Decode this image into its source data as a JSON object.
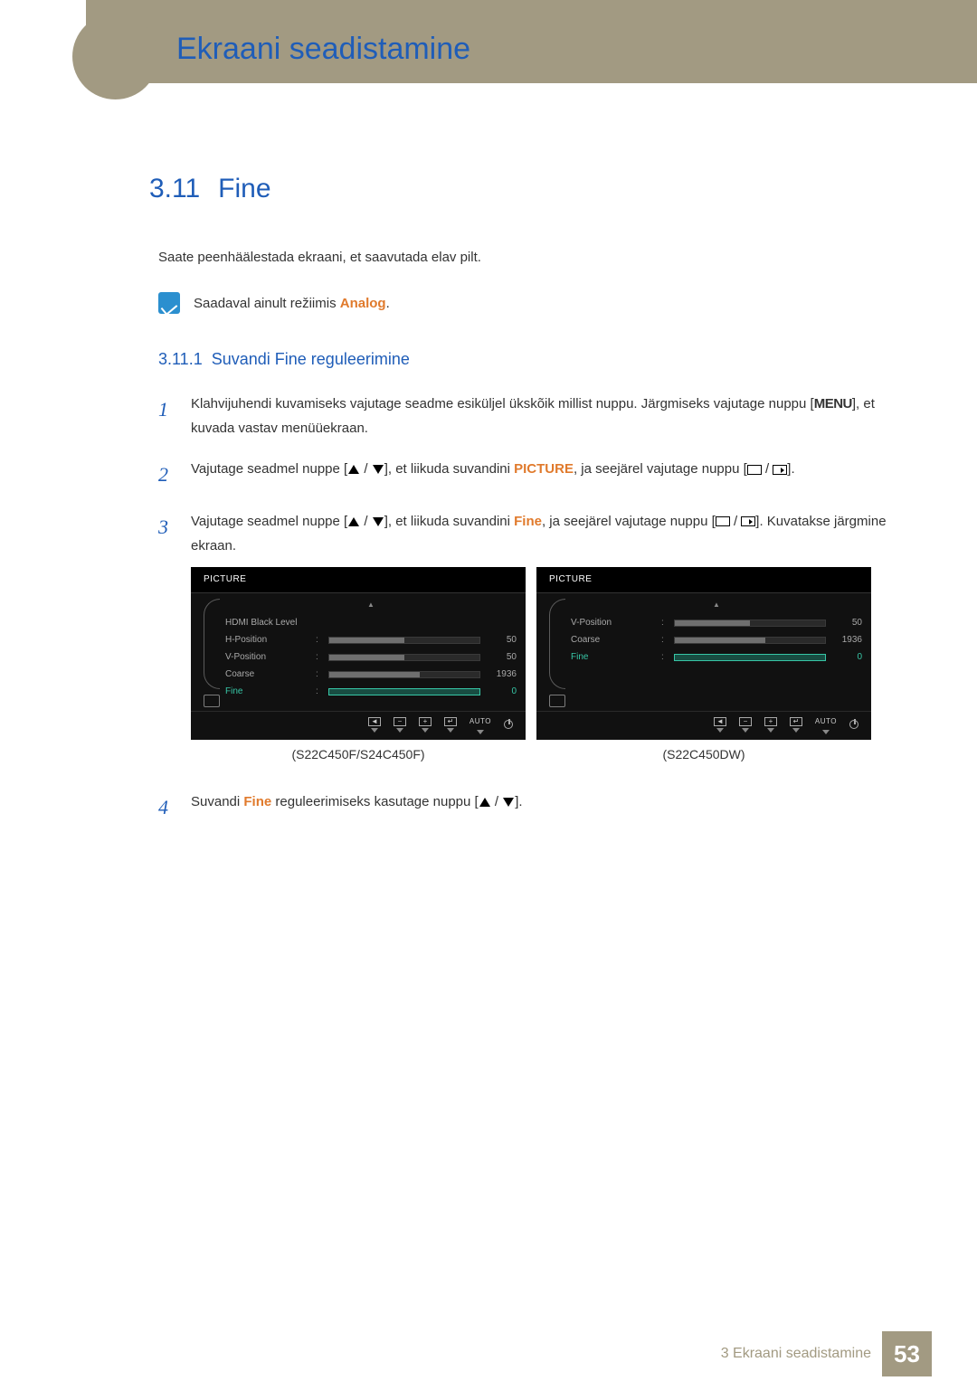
{
  "header": {
    "chapter_title": "Ekraani seadistamine"
  },
  "section": {
    "number": "3.11",
    "title": "Fine"
  },
  "intro": "Saate peenhäälestada ekraani, et saavutada elav pilt.",
  "note": {
    "prefix": "Saadaval ainult režiimis ",
    "highlight": "Analog",
    "suffix": "."
  },
  "subsection": {
    "number": "3.11.1",
    "title": "Suvandi Fine reguleerimine"
  },
  "steps": {
    "s1": {
      "num": "1",
      "text_a": "Klahvijuhendi kuvamiseks vajutage seadme esiküljel ükskõik millist nuppu. Järgmiseks vajutage nuppu [",
      "menu": "MENU",
      "text_b": "], et kuvada vastav menüüekraan."
    },
    "s2": {
      "num": "2",
      "text_a": "Vajutage seadmel nuppe [",
      "text_mid": "], et liikuda suvandini ",
      "highlight": "PICTURE",
      "text_b": ", ja seejärel vajutage nuppu [",
      "text_c": "]."
    },
    "s3": {
      "num": "3",
      "text_a": "Vajutage seadmel nuppe [",
      "text_mid": "], et liikuda suvandini ",
      "highlight": "Fine",
      "text_b": ", ja seejärel vajutage nuppu [",
      "text_c": "]. Kuvatakse järgmine ekraan."
    },
    "s4": {
      "num": "4",
      "text_a": "Suvandi ",
      "highlight": "Fine",
      "text_b": " reguleerimiseks kasutage nuppu [",
      "text_c": "]."
    }
  },
  "osd": {
    "left": {
      "title": "PICTURE",
      "items": [
        {
          "label": "HDMI Black Level",
          "value": "",
          "pct": 0,
          "selected": false,
          "nobar": true
        },
        {
          "label": "H-Position",
          "value": "50",
          "pct": 50,
          "selected": false
        },
        {
          "label": "V-Position",
          "value": "50",
          "pct": 50,
          "selected": false
        },
        {
          "label": "Coarse",
          "value": "1936",
          "pct": 60,
          "selected": false
        },
        {
          "label": "Fine",
          "value": "0",
          "pct": 0,
          "selected": true
        }
      ],
      "controls_auto": "AUTO",
      "caption": "(S22C450F/S24C450F)"
    },
    "right": {
      "title": "PICTURE",
      "items": [
        {
          "label": "V-Position",
          "value": "50",
          "pct": 50,
          "selected": false
        },
        {
          "label": "Coarse",
          "value": "1936",
          "pct": 60,
          "selected": false
        },
        {
          "label": "Fine",
          "value": "0",
          "pct": 0,
          "selected": true
        }
      ],
      "controls_auto": "AUTO",
      "caption": "(S22C450DW)"
    }
  },
  "footer": {
    "label": "3 Ekraani seadistamine",
    "page": "53"
  }
}
